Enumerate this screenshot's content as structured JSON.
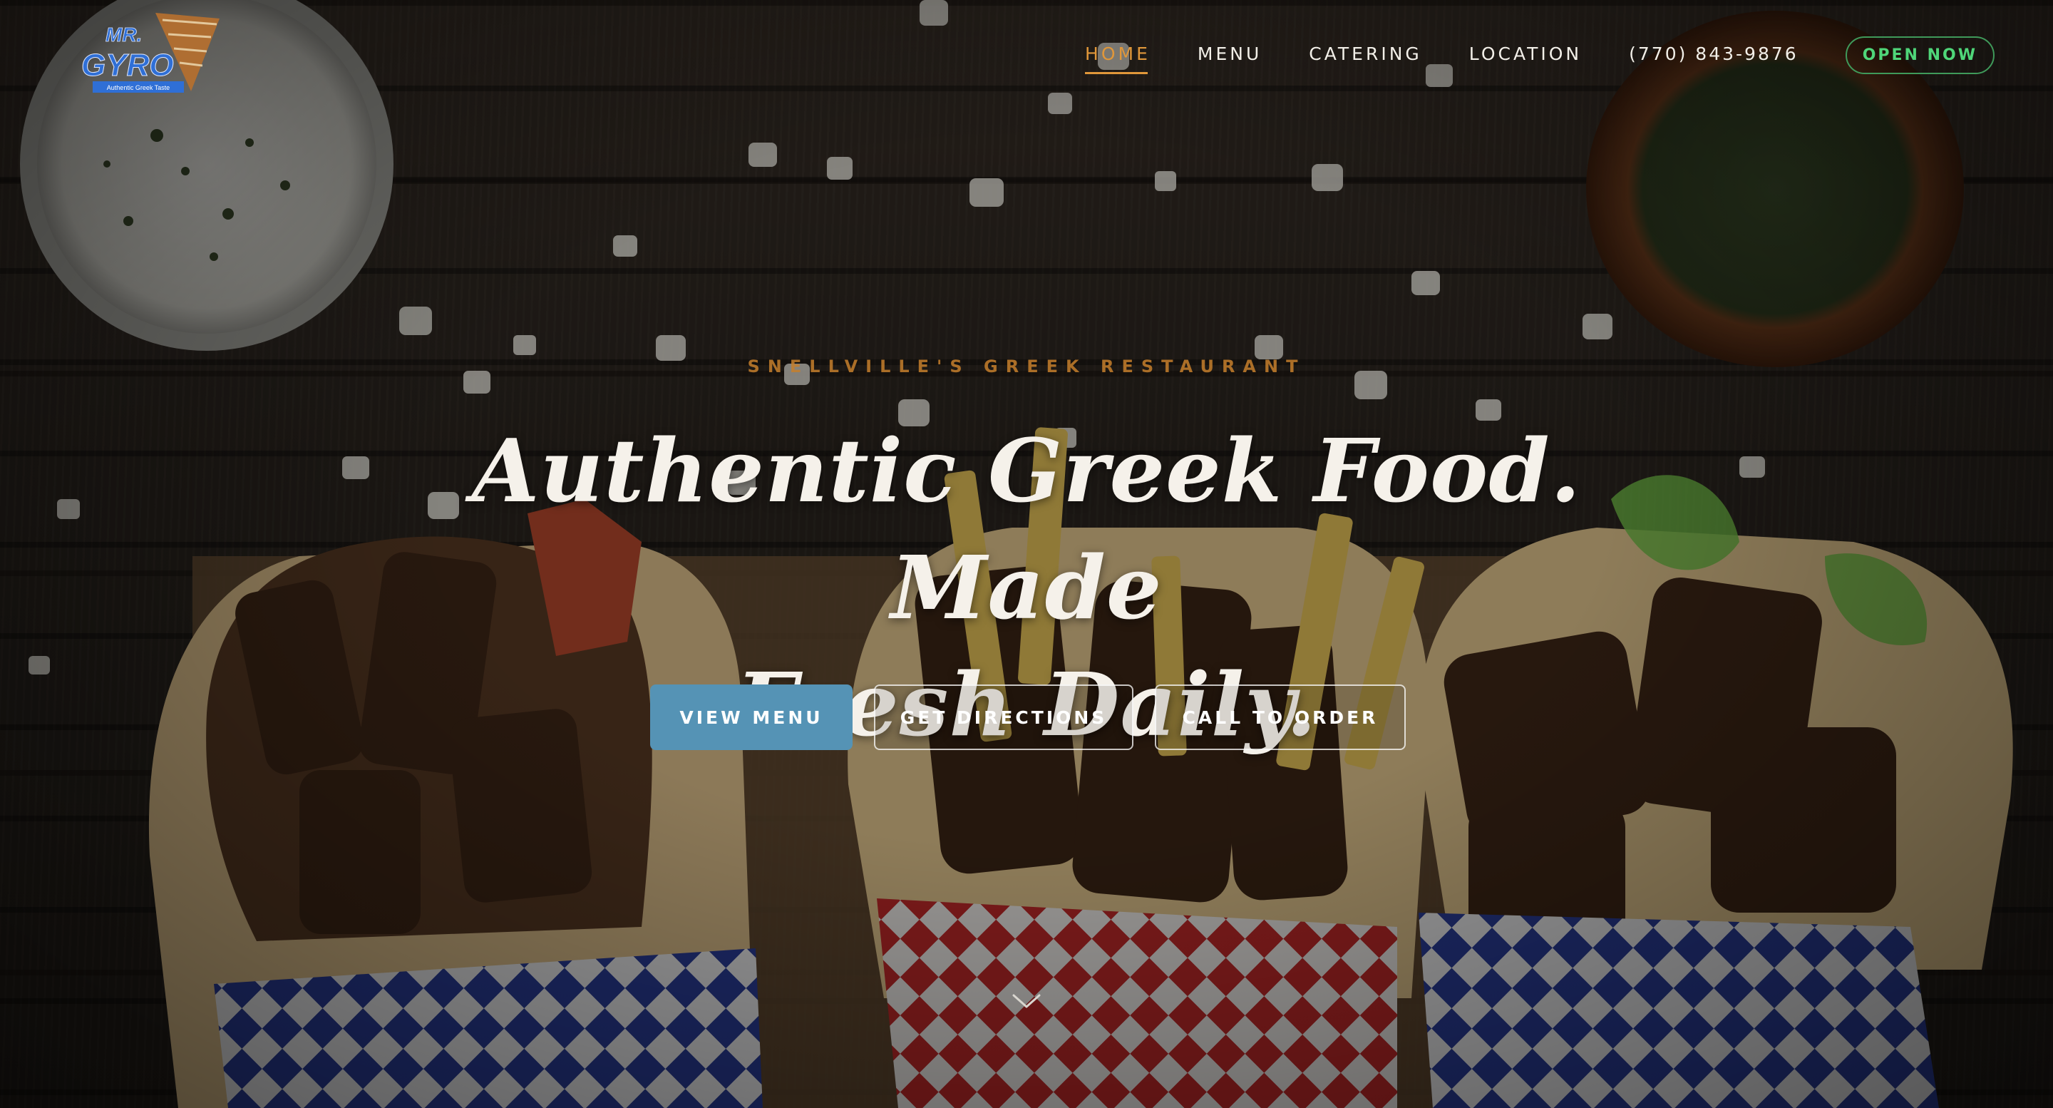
{
  "brand": {
    "logo_text_line1": "MR.",
    "logo_text_line2": "GYRO",
    "logo_tagline": "Authentic Greek Taste",
    "logo_color": "#2f6fd6"
  },
  "nav": {
    "items": [
      {
        "label": "HOME",
        "active": true
      },
      {
        "label": "MENU",
        "active": false
      },
      {
        "label": "CATERING",
        "active": false
      },
      {
        "label": "LOCATION",
        "active": false
      }
    ],
    "phone": "(770) 843-9876",
    "status_badge": "OPEN NOW"
  },
  "hero": {
    "eyebrow": "SNELLVILLE'S GREEK RESTAURANT",
    "headline_line1": "Authentic Greek Food. Made",
    "headline_line2": "Fresh Daily.",
    "buttons": {
      "primary": "VIEW MENU",
      "directions": "GET DIRECTIONS",
      "call": "CALL TO ORDER"
    },
    "scroll_icon": "chevron-down-icon"
  },
  "colors": {
    "accent_orange": "#e0973a",
    "primary_button": "#5593b5",
    "open_green": "#4fd679",
    "headline": "#f5f1ea"
  }
}
